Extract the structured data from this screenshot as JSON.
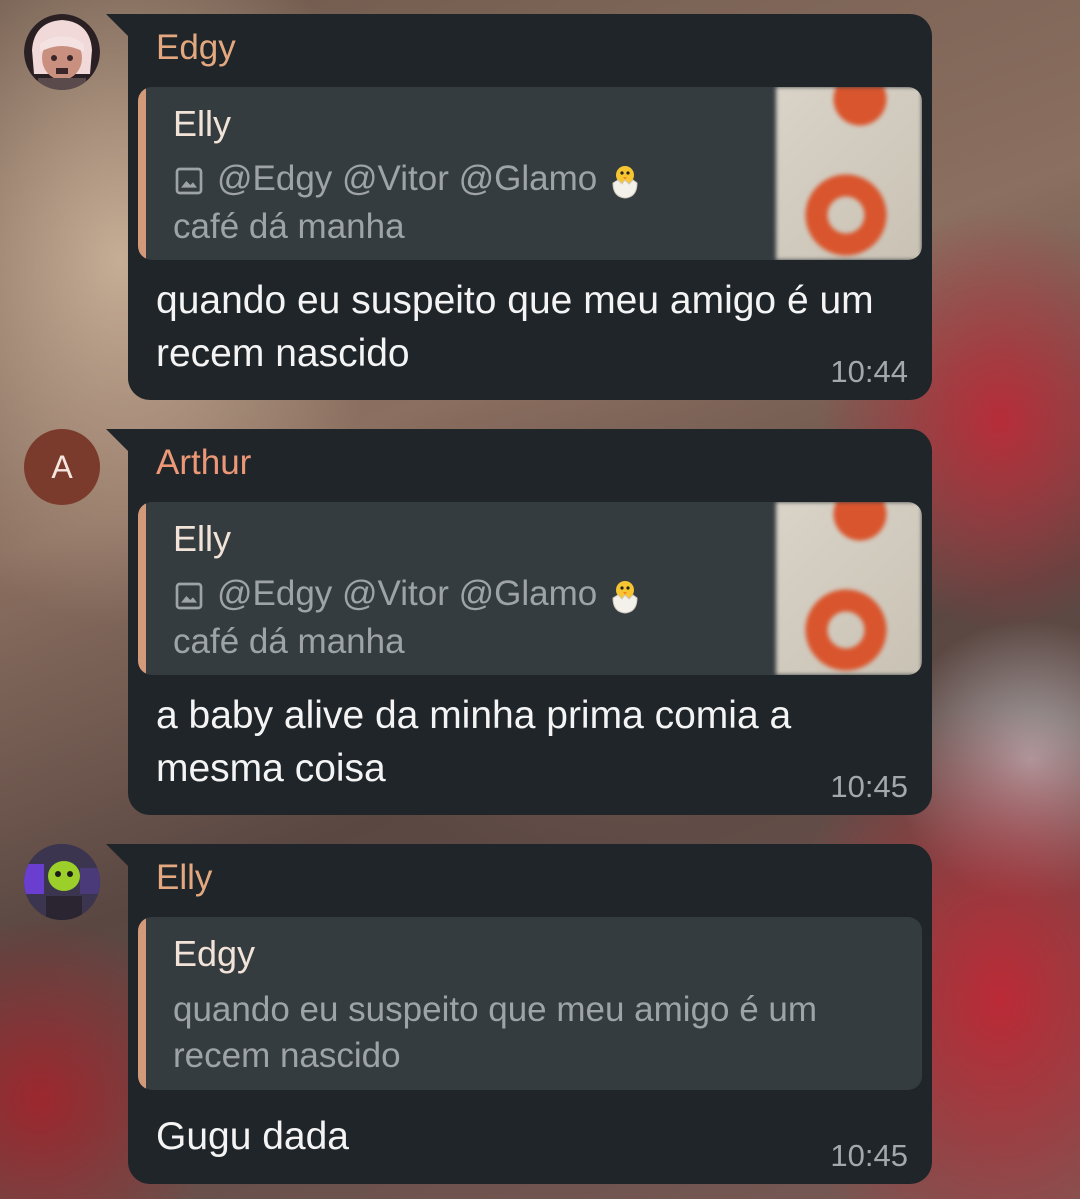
{
  "messages": [
    {
      "sender": "Edgy",
      "sender_color": "#e3a87f",
      "reply": {
        "name": "Elly",
        "mentions": "@Edgy @Vitor @Glamo",
        "caption": "café dá manha"
      },
      "text": "quando eu suspeito que meu amigo é um recem nascido",
      "time": "10:44"
    },
    {
      "sender": "Arthur",
      "sender_color": "#ec9877",
      "avatar_letter": "A",
      "reply": {
        "name": "Elly",
        "mentions": "@Edgy @Vitor @Glamo",
        "caption": "café dá manha"
      },
      "text": "a baby alive da minha prima comia a mesma coisa",
      "time": "10:45"
    },
    {
      "sender": "Elly",
      "sender_color": "#e3a87f",
      "reply": {
        "name": "Edgy",
        "quote": "quando eu suspeito que meu amigo é um recem nascido"
      },
      "text": "Gugu dada",
      "time": "10:45"
    }
  ]
}
